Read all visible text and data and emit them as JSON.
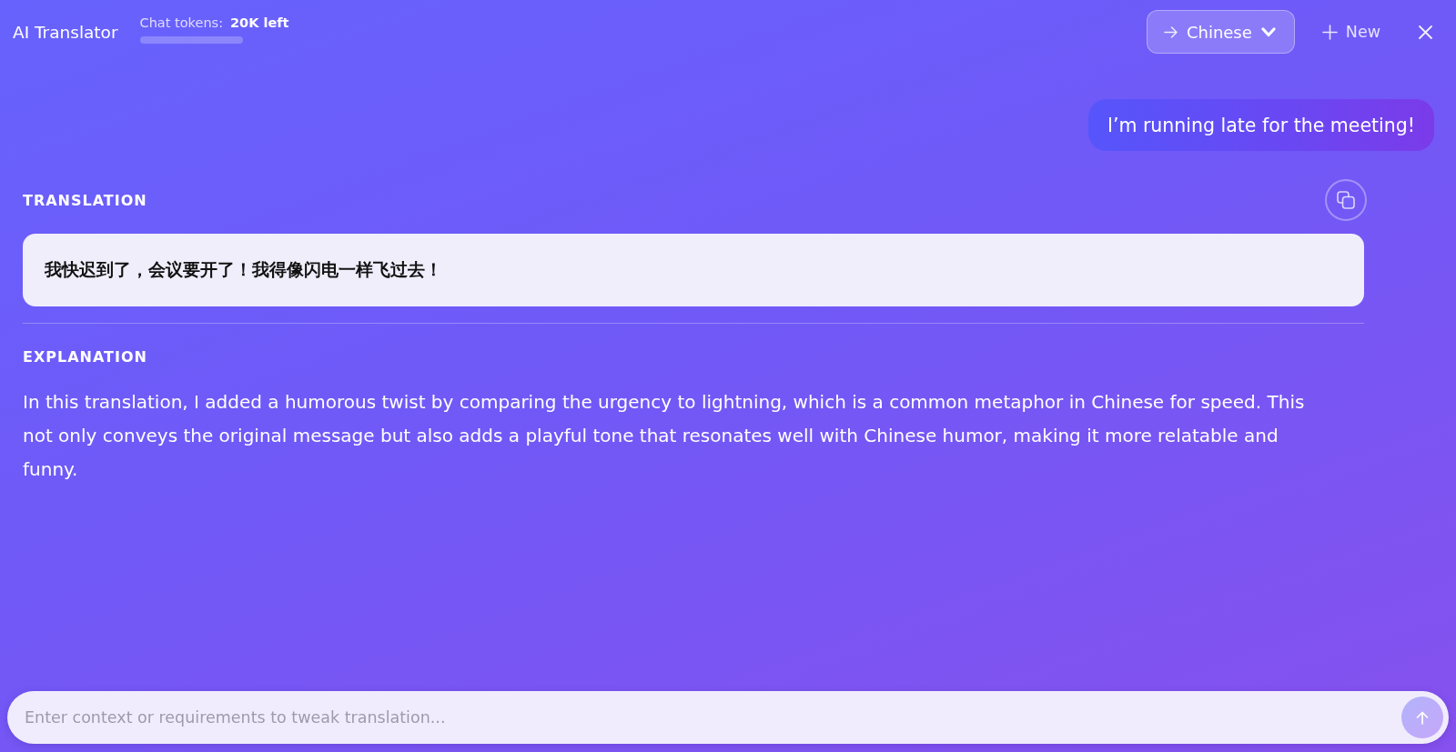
{
  "header": {
    "title": "AI Translator",
    "tokens_label": "Chat tokens:",
    "tokens_remaining": "20K left",
    "token_meter": {
      "level": 1
    }
  },
  "toolbar": {
    "language_button": {
      "label": "Chinese"
    },
    "new_button": {
      "label": "New"
    }
  },
  "message": {
    "text": "I’m running late for the meeting!"
  },
  "translation": {
    "heading": "TRANSLATION",
    "text": "我快迟到了，会议要开了！我得像闪电一样飞过去！"
  },
  "explanation": {
    "heading": "EXPLANATION",
    "text": "In this translation, I added a humorous twist by comparing the urgency to lightning, which is a common metaphor in Chinese for speed. This not only conveys the original message but also adds a playful tone that resonates well with Chinese humor, making it more relatable and funny."
  },
  "composer": {
    "placeholder": "Enter context or requirements to tweak translation...",
    "send_button": {
      "disabled": true
    }
  }
}
